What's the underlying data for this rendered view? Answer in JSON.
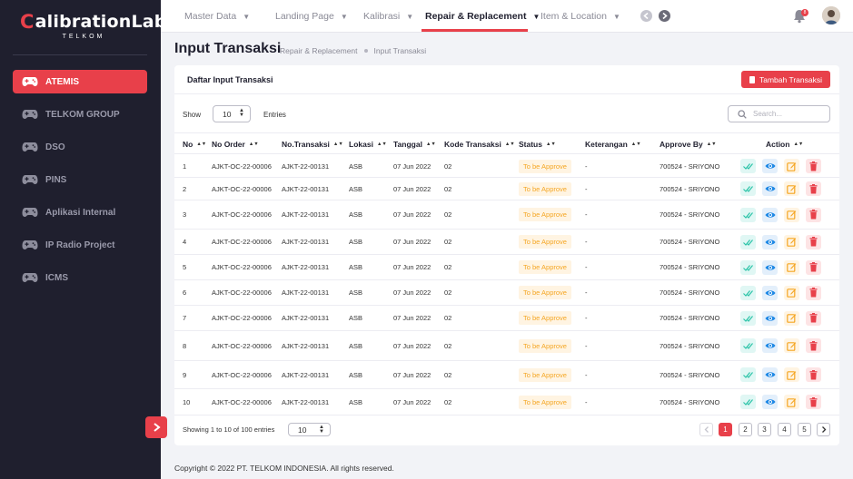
{
  "brand": {
    "name_c": "C",
    "name_rest": "alibrationLab",
    "sub": "TELKOM"
  },
  "sidebar": {
    "items": [
      {
        "label": "ATEMIS",
        "active": true
      },
      {
        "label": "TELKOM GROUP",
        "active": false
      },
      {
        "label": "DSO",
        "active": false
      },
      {
        "label": "PINS",
        "active": false
      },
      {
        "label": "Aplikasi Internal",
        "active": false
      },
      {
        "label": "IP Radio Project",
        "active": false
      },
      {
        "label": "ICMS",
        "active": false
      }
    ],
    "expand_icon": "chevron-right"
  },
  "topnav": {
    "items": [
      {
        "label": "Master Data",
        "active": false
      },
      {
        "label": "Landing Page",
        "active": false
      },
      {
        "label": "Kalibrasi",
        "active": false
      },
      {
        "label": "Repair & Replacement",
        "active": true
      },
      {
        "label": "Item & Location",
        "active": false
      }
    ],
    "notification_count": "8"
  },
  "page": {
    "title": "Input Transaksi",
    "breadcrumb": [
      "Repair & Replacement",
      "Input Transaksi"
    ]
  },
  "card": {
    "title": "Daftar Input Transaksi",
    "add_button": "Tambah Transaksi",
    "show_label": "Show",
    "show_value": "10",
    "entries_label": "Entries",
    "search_placeholder": "Search..."
  },
  "table": {
    "columns": [
      "No",
      "No Order",
      "No.Transaksi",
      "Lokasi",
      "Tanggal",
      "Kode Transaksi",
      "Status",
      "Keterangan",
      "Approve By",
      "Action"
    ],
    "rows": [
      {
        "no": "1",
        "order": "AJKT-OC-22-00006",
        "trans": "AJKT-22-00131",
        "lokasi": "ASB",
        "tanggal": "07 Jun 2022",
        "kode": "02",
        "status": "To be Approve",
        "ket": "-",
        "approve": "700524 - SRIYONO"
      },
      {
        "no": "2",
        "order": "AJKT-OC-22-00006",
        "trans": "AJKT-22-00131",
        "lokasi": "ASB",
        "tanggal": "07 Jun 2022",
        "kode": "02",
        "status": "To be Approve",
        "ket": "-",
        "approve": "700524 - SRIYONO"
      },
      {
        "no": "3",
        "order": "AJKT-OC-22-00006",
        "trans": "AJKT-22-00131",
        "lokasi": "ASB",
        "tanggal": "07 Jun 2022",
        "kode": "02",
        "status": "To be Approve",
        "ket": "-",
        "approve": "700524 - SRIYONO"
      },
      {
        "no": "4",
        "order": "AJKT-OC-22-00006",
        "trans": "AJKT-22-00131",
        "lokasi": "ASB",
        "tanggal": "07 Jun 2022",
        "kode": "02",
        "status": "To be Approve",
        "ket": "-",
        "approve": "700524 - SRIYONO"
      },
      {
        "no": "5",
        "order": "AJKT-OC-22-00006",
        "trans": "AJKT-22-00131",
        "lokasi": "ASB",
        "tanggal": "07 Jun 2022",
        "kode": "02",
        "status": "To be Approve",
        "ket": "-",
        "approve": "700524 - SRIYONO"
      },
      {
        "no": "6",
        "order": "AJKT-OC-22-00006",
        "trans": "AJKT-22-00131",
        "lokasi": "ASB",
        "tanggal": "07 Jun 2022",
        "kode": "02",
        "status": "To be Approve",
        "ket": "-",
        "approve": "700524 - SRIYONO"
      },
      {
        "no": "7",
        "order": "AJKT-OC-22-00006",
        "trans": "AJKT-22-00131",
        "lokasi": "ASB",
        "tanggal": "07 Jun 2022",
        "kode": "02",
        "status": "To be Approve",
        "ket": "-",
        "approve": "700524 - SRIYONO"
      },
      {
        "no": "8",
        "order": "AJKT-OC-22-00006",
        "trans": "AJKT-22-00131",
        "lokasi": "ASB",
        "tanggal": "07 Jun 2022",
        "kode": "02",
        "status": "To be Approve",
        "ket": "-",
        "approve": "700524 - SRIYONO"
      },
      {
        "no": "9",
        "order": "AJKT-OC-22-00006",
        "trans": "AJKT-22-00131",
        "lokasi": "ASB",
        "tanggal": "07 Jun 2022",
        "kode": "02",
        "status": "To be Approve",
        "ket": "-",
        "approve": "700524 - SRIYONO"
      },
      {
        "no": "10",
        "order": "AJKT-OC-22-00006",
        "trans": "AJKT-22-00131",
        "lokasi": "ASB",
        "tanggal": "07 Jun 2022",
        "kode": "02",
        "status": "To be Approve",
        "ket": "-",
        "approve": "700524 - SRIYONO"
      }
    ],
    "actions": [
      "check-icon",
      "eye-icon",
      "edit-icon",
      "trash-icon"
    ]
  },
  "footer": {
    "showing": "Showing 1 to 10 of 100 entries",
    "page_size": "10",
    "pages": [
      "1",
      "2",
      "3",
      "4",
      "5"
    ],
    "current_page": "1"
  },
  "copyright": "Copyright  ©  2022 PT. TELKOM INDONESIA. All rights reserved.",
  "colors": {
    "accent": "#e8404a",
    "sidebar": "#1f1f2e",
    "status_text": "#f5a623",
    "status_bg": "#fff4e2"
  }
}
